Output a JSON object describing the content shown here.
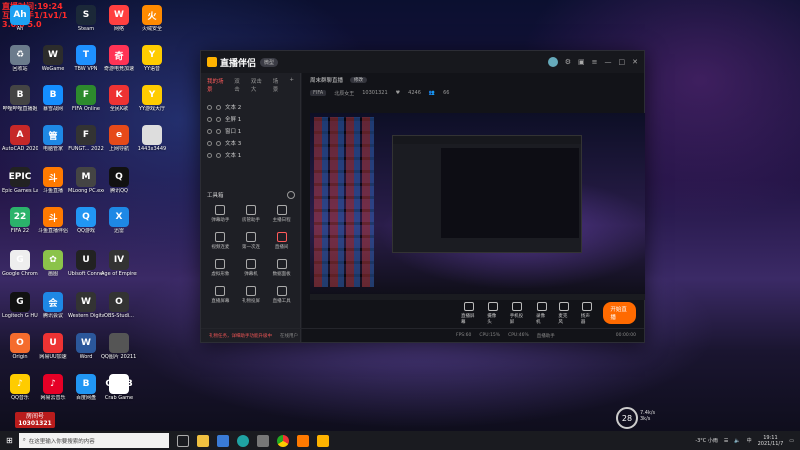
{
  "overlay": {
    "line1": "直播时间:19:24",
    "line2": "互动助手1/1v1/1",
    "line3": "3.0/0   5.0"
  },
  "desktop_icons": [
    {
      "label": "Ah",
      "color": "#1da1f2",
      "glyph": "Ah"
    },
    {
      "label": "Steam",
      "color": "#1b2838",
      "glyph": "S"
    },
    {
      "label": "网络",
      "color": "#ff4040",
      "glyph": "W"
    },
    {
      "label": "火绒安全",
      "color": "#ff8a00",
      "glyph": "火"
    },
    {
      "label": "Corel Setup",
      "color": "#ffcc00",
      "glyph": "C"
    },
    {
      "label": "回收站",
      "color": "#6b7b8c",
      "glyph": "♻"
    },
    {
      "label": "WeGame",
      "color": "#2c2c2c",
      "glyph": "W"
    },
    {
      "label": "TBW VPN",
      "color": "#1e90ff",
      "glyph": "T"
    },
    {
      "label": "奇游电竞加速",
      "color": "#ff3355",
      "glyph": "奇"
    },
    {
      "label": "YY语音",
      "color": "#ffcc00",
      "glyph": "Y"
    },
    {
      "label": "哔哩哔哩直播姬",
      "color": "#444",
      "glyph": "B"
    },
    {
      "label": "暴雪战网",
      "color": "#148eff",
      "glyph": "B"
    },
    {
      "label": "FIFA Online",
      "color": "#2d8a2d",
      "glyph": "F"
    },
    {
      "label": "全民K歌",
      "color": "#e33",
      "glyph": "K"
    },
    {
      "label": "YY游戏大厅",
      "color": "#ffcc00",
      "glyph": "Y"
    },
    {
      "label": "AutoCAD 2020 - 简体",
      "color": "#c62828",
      "glyph": "A"
    },
    {
      "label": "电脑管家",
      "color": "#1e88e5",
      "glyph": "管"
    },
    {
      "label": "FUNGT... 2022",
      "color": "#333",
      "glyph": "F"
    },
    {
      "label": "上网导航",
      "color": "#e64a19",
      "glyph": "e"
    },
    {
      "label": "1443x3449",
      "color": "#ddd",
      "glyph": ""
    },
    {
      "label": "Epic Games Launcher",
      "color": "#222",
      "glyph": "EPIC"
    },
    {
      "label": "斗鱼直播",
      "color": "#ff7a00",
      "glyph": "斗"
    },
    {
      "label": "MLoong PC.exe",
      "color": "#444",
      "glyph": "M"
    },
    {
      "label": "腾讯QQ",
      "color": "#111",
      "glyph": "Q"
    },
    {
      "label": "FIFA 22",
      "color": "#2bb36b",
      "glyph": "22"
    },
    {
      "label": "斗鱼直播伴侣",
      "color": "#ff7a00",
      "glyph": "斗"
    },
    {
      "label": "QQ游戏",
      "color": "#2196f3",
      "glyph": "Q"
    },
    {
      "label": "迅雷",
      "color": "#1e88e5",
      "glyph": "X"
    },
    {
      "label": "Google Chrome",
      "color": "#eee",
      "glyph": "G"
    },
    {
      "label": "画图",
      "color": "#8bc34a",
      "glyph": "✿"
    },
    {
      "label": "Ubisoft Connect",
      "color": "#222",
      "glyph": "U"
    },
    {
      "label": "Age of Empires IV",
      "color": "#333",
      "glyph": "IV"
    },
    {
      "label": "Logitech G HUB",
      "color": "#111",
      "glyph": "G"
    },
    {
      "label": "腾讯会议",
      "color": "#1e88e5",
      "glyph": "会"
    },
    {
      "label": "Western Digital U...",
      "color": "#333",
      "glyph": "W"
    },
    {
      "label": "OBS-Studi...",
      "color": "#333",
      "glyph": "O"
    },
    {
      "label": "Origin",
      "color": "#f56c2d",
      "glyph": "O"
    },
    {
      "label": "网易UU加速",
      "color": "#e33",
      "glyph": "U"
    },
    {
      "label": "Word",
      "color": "#2b579a",
      "glyph": "W"
    },
    {
      "label": "QQ图片 20211104...",
      "color": "#555",
      "glyph": ""
    },
    {
      "label": "QQ音乐",
      "color": "#ffcc00",
      "glyph": "♪"
    },
    {
      "label": "网易云音乐",
      "color": "#e60026",
      "glyph": "♪"
    },
    {
      "label": "百度网盘",
      "color": "#2196f3",
      "glyph": "B"
    },
    {
      "label": "Crab Game",
      "color": "#fff",
      "glyph": "CRAB"
    }
  ],
  "room_overlay": {
    "label": "房间号",
    "number": "10301321"
  },
  "app": {
    "logo": "直播伴侣",
    "badge": "微型",
    "left_tabs": [
      "我的场景",
      "双击",
      "双击大",
      "场景",
      "+"
    ],
    "sources": [
      "文本 2",
      "全屏 1",
      "窗口 1",
      "文本 3",
      "文本 1"
    ],
    "tools_title": "工具箱",
    "tools": [
      "弹幕助手",
      "房管助手",
      "主播日程",
      "视频连麦",
      "第一次连",
      "直播间",
      "虚拟形象",
      "弹幕机",
      "数据面板",
      "直播屏幕",
      "礼物投屏",
      "直播工具"
    ],
    "room_title": "周末群聊直播",
    "room_tag": "修改",
    "info": {
      "tag": "FIFA",
      "name": "北辰女王",
      "id": "10301321",
      "likes": "4246",
      "fans": "66"
    },
    "controls": [
      "直播屏幕",
      "摄像头",
      "手机投屏",
      "录像机",
      "麦克风",
      "扬声器"
    ],
    "golive": "开始直播",
    "status": [
      "礼物任务，详细助手功能升级中",
      "在线用户",
      "FPS:60",
      "CPU:15%",
      "CPU:46%",
      "直播助手"
    ],
    "timer": "00:00:00"
  },
  "taskbar": {
    "search_placeholder": "在这里输入你要搜索的内容",
    "weather": "-3°C 小雨",
    "time": "19:11",
    "date": "2021/11/7"
  },
  "widgets": {
    "temp": "28",
    "fps_line1": "7.4k/s",
    "fps_line2": "3k/s"
  }
}
